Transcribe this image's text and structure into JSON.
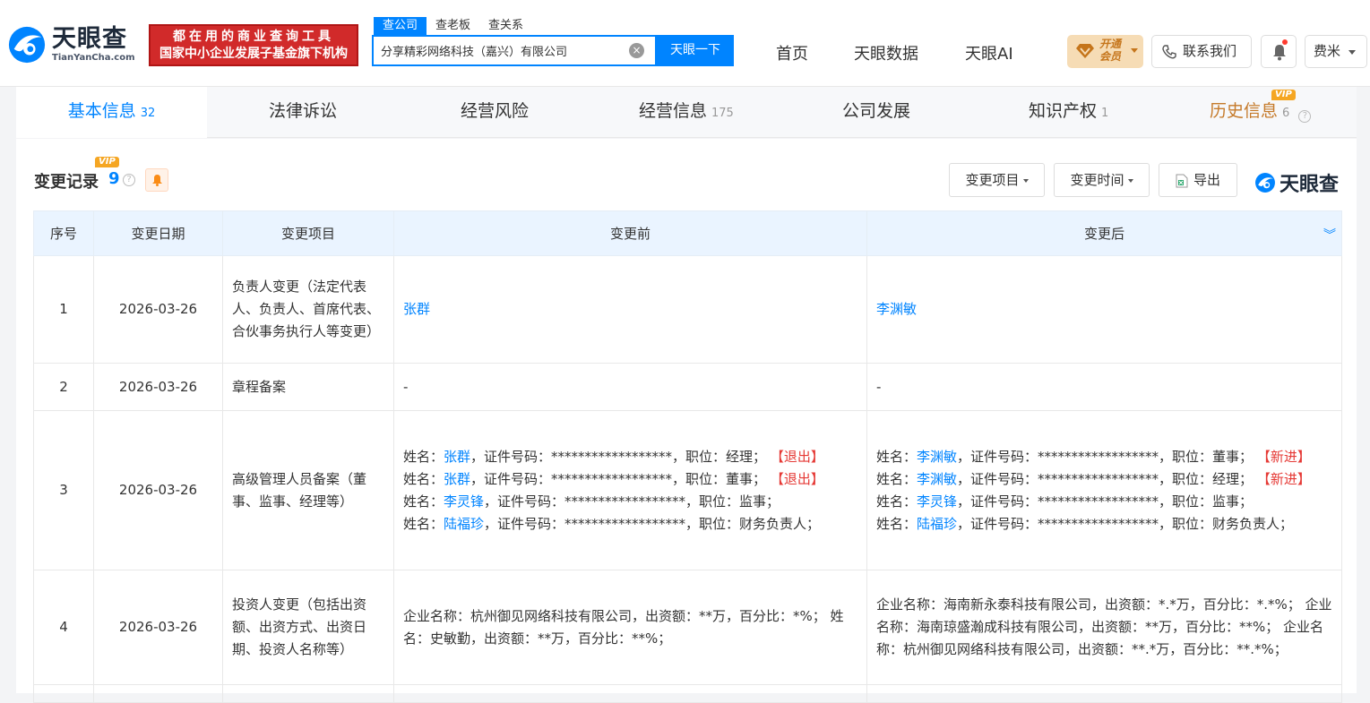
{
  "header": {
    "logo_cn": "天眼查",
    "logo_en": "TianYanCha.com",
    "ad_line1": "都在用的商业查询工具",
    "ad_line2": "国家中小企业发展子基金旗下机构",
    "search_tabs": [
      "查公司",
      "查老板",
      "查关系"
    ],
    "search_value": "分享精彩网络科技（嘉兴）有限公司",
    "search_button": "天眼一下",
    "nav": [
      "首页",
      "天眼数据",
      "天眼AI"
    ],
    "vip_line1": "开通",
    "vip_line2": "会员",
    "contact": "联系我们",
    "user": "费米"
  },
  "tabs": [
    {
      "label": "基本信息",
      "count": "32"
    },
    {
      "label": "法律诉讼",
      "count": ""
    },
    {
      "label": "经营风险",
      "count": ""
    },
    {
      "label": "经营信息",
      "count": "175"
    },
    {
      "label": "公司发展",
      "count": ""
    },
    {
      "label": "知识产权",
      "count": "1"
    },
    {
      "label": "历史信息",
      "count": "6"
    }
  ],
  "vip_tag": "VIP",
  "section": {
    "title": "变更记录",
    "count": "9",
    "filter1": "变更项目",
    "filter2": "变更时间",
    "export": "导出",
    "brand": "天眼查"
  },
  "table": {
    "headers": [
      "序号",
      "变更日期",
      "变更项目",
      "变更前",
      "变更后"
    ],
    "rows": [
      {
        "no": "1",
        "date": "2026-03-26",
        "item": "负责人变更（法定代表人、负责人、首席代表、合伙事务执行人等变更）",
        "before_name": "张群",
        "after_name": "李渊敏"
      },
      {
        "no": "2",
        "date": "2026-03-26",
        "item": "章程备案",
        "before": "-",
        "after": "-"
      },
      {
        "no": "3",
        "date": "2026-03-26",
        "item": "高级管理人员备案（董事、监事、经理等）"
      },
      {
        "no": "4",
        "date": "2026-03-26",
        "item": "投资人变更（包括出资额、出资方式、出资日期、投资人名称等）",
        "before": "企业名称：杭州御见网络科技有限公司，出资额：**万，百分比：*%； 姓名：史敏勤，出资额：**万，百分比：**%；",
        "after": "企业名称：海南新永泰科技有限公司，出资额：*.*万，百分比：*.*%； 企业名称：海南琼盛瀚成科技有限公司，出资额：**万，百分比：**%； 企业名称：杭州御见网络科技有限公司，出资额：**.*万，百分比：**.*%；"
      }
    ],
    "row3_before": [
      {
        "pre": "姓名：",
        "name": "张群",
        "mid": "，证件号码：******************，职位：经理；",
        "tag": "【退出】"
      },
      {
        "pre": "姓名：",
        "name": "张群",
        "mid": "，证件号码：******************，职位：董事；",
        "tag": "【退出】"
      },
      {
        "pre": "姓名：",
        "name": "李灵锋",
        "mid": "，证件号码：******************，职位：监事；",
        "tag": ""
      },
      {
        "pre": "姓名：",
        "name": "陆福珍",
        "mid": "，证件号码：******************，职位：财务负责人；",
        "tag": ""
      }
    ],
    "row3_after": [
      {
        "pre": "姓名：",
        "name": "李渊敏",
        "mid": "，证件号码：******************，职位：董事；",
        "tag": "【新进】"
      },
      {
        "pre": "姓名：",
        "name": "李渊敏",
        "mid": "，证件号码：******************，职位：经理；",
        "tag": "【新进】"
      },
      {
        "pre": "姓名：",
        "name": "李灵锋",
        "mid": "，证件号码：******************，职位：监事；",
        "tag": ""
      },
      {
        "pre": "姓名：",
        "name": "陆福珍",
        "mid": "，证件号码：******************，职位：财务负责人；",
        "tag": ""
      }
    ]
  },
  "colors": {
    "accent": "#0084ff",
    "red": "#e53935",
    "vip": "#f5a623"
  }
}
